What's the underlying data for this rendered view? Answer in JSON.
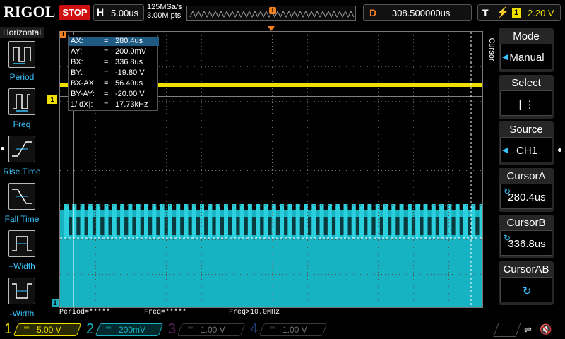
{
  "top_bar": {
    "logo": "RIGOL",
    "run_state": "STOP",
    "horizontal_key": "H",
    "timebase": "5.00us",
    "sample_rate": "125MSa/s",
    "memory_depth": "3.00M pts",
    "delay_key": "D",
    "delay_value": "308.500000us",
    "trigger_key": "T",
    "trigger_source": "1",
    "trigger_level": "2.20 V"
  },
  "left_menu": {
    "title": "Horizontal",
    "items": [
      {
        "label": "Period"
      },
      {
        "label": "Freq"
      },
      {
        "label": "Rise Time"
      },
      {
        "label": "Fall Time"
      },
      {
        "label": "+Width"
      },
      {
        "label": "-Width"
      }
    ]
  },
  "cursor_info": {
    "rows": [
      {
        "name": "AX:",
        "eq": "=",
        "value": "280.4us"
      },
      {
        "name": "AY:",
        "eq": "=",
        "value": "200.0mV"
      },
      {
        "name": "BX:",
        "eq": "=",
        "value": "336.8us"
      },
      {
        "name": "BY:",
        "eq": "=",
        "value": "-19.80 V"
      },
      {
        "name": "BX-AX:",
        "eq": "=",
        "value": "56.40us"
      },
      {
        "name": "BY-AY:",
        "eq": "=",
        "value": "-20.00 V"
      },
      {
        "name": "1/|dX|:",
        "eq": "=",
        "value": "17.73kHz"
      }
    ]
  },
  "markers": {
    "ch1": "1",
    "ch2": "2",
    "trigger": "T"
  },
  "measurements": [
    {
      "text": "Period=*****"
    },
    {
      "text": "Freq=*****"
    },
    {
      "text": "Freq>10.0MHz"
    }
  ],
  "right_menu": {
    "side_label": "Cursor",
    "buttons": [
      {
        "title": "Mode",
        "value": "Manual"
      },
      {
        "title": "Select",
        "value": "| ⋮"
      },
      {
        "title": "Source",
        "value": "CH1"
      },
      {
        "title": "CursorA",
        "value": "280.4us"
      },
      {
        "title": "CursorB",
        "value": "336.8us"
      },
      {
        "title": "CursorAB",
        "value": "↻"
      }
    ]
  },
  "channels": [
    {
      "num": "1",
      "coupling": "═",
      "scale": "5.00 V",
      "color": "#f0e000",
      "active": true
    },
    {
      "num": "2",
      "coupling": "═",
      "scale": "200mV",
      "color": "#17b3c2",
      "active": true
    },
    {
      "num": "3",
      "coupling": "═",
      "scale": "1.00 V",
      "color": "#b01aa8",
      "active": false
    },
    {
      "num": "4",
      "coupling": "═",
      "scale": "1.00 V",
      "color": "#2050d8",
      "active": false
    }
  ],
  "colors": {
    "ch1": "#f0e000",
    "ch2": "#17b3c2",
    "accent_blue": "#39c4ff",
    "trigger_orange": "#f08020",
    "stop_red": "#d01010"
  },
  "icons": {
    "usb": "usb-icon",
    "speaker": "speaker-muted-icon"
  }
}
